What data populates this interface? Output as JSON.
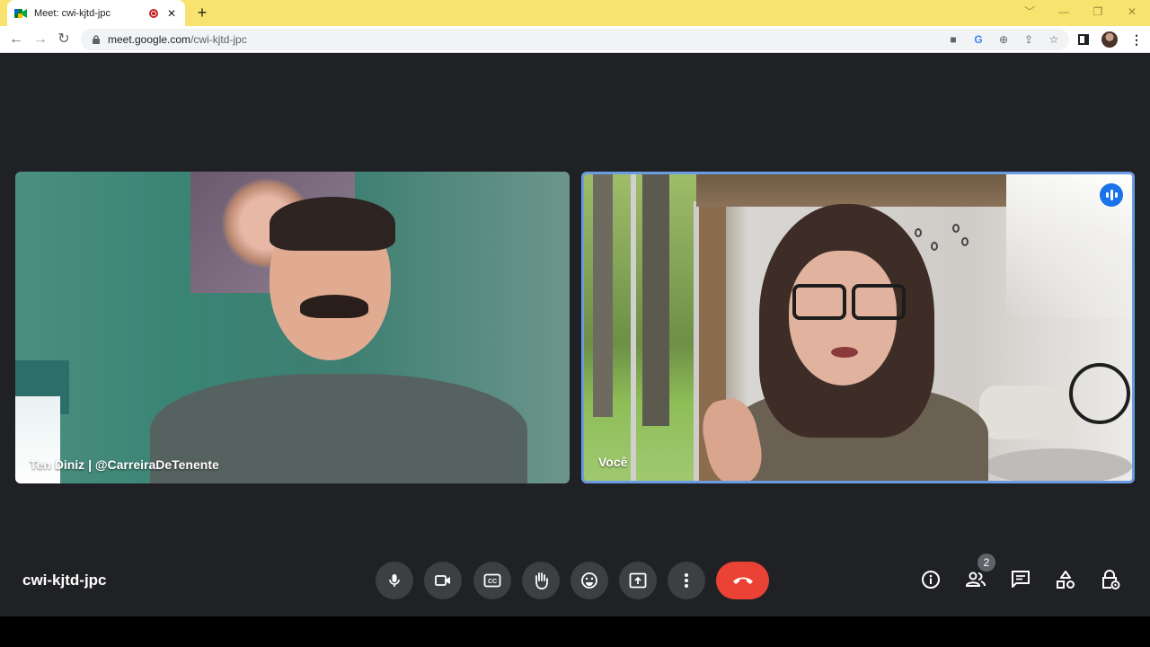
{
  "browser": {
    "tab_title": "Meet: cwi-kjtd-jpc",
    "tab_close": "✕",
    "new_tab": "+",
    "url_host": "meet.google.com",
    "url_path": "/cwi-kjtd-jpc",
    "window_controls": [
      "﹀",
      "—",
      "❐",
      "✕"
    ]
  },
  "meet": {
    "meeting_code": "cwi-kjtd-jpc",
    "participants": [
      {
        "name": "Ten Diniz | @CarreiraDeTenente"
      },
      {
        "name": "Você",
        "speaking": true
      }
    ],
    "participants_count": "2",
    "controls": [
      "microphone",
      "camera",
      "captions",
      "raise-hand",
      "emoji",
      "present",
      "more-options",
      "leave-call"
    ],
    "right_controls": [
      "meeting-details",
      "people",
      "chat",
      "activities",
      "host-controls"
    ],
    "colors": {
      "background": "#202124",
      "control": "#3c4043",
      "hangup": "#ea4335",
      "speaking_border": "#6b9be0",
      "tabbar": "#f8e36e"
    }
  }
}
